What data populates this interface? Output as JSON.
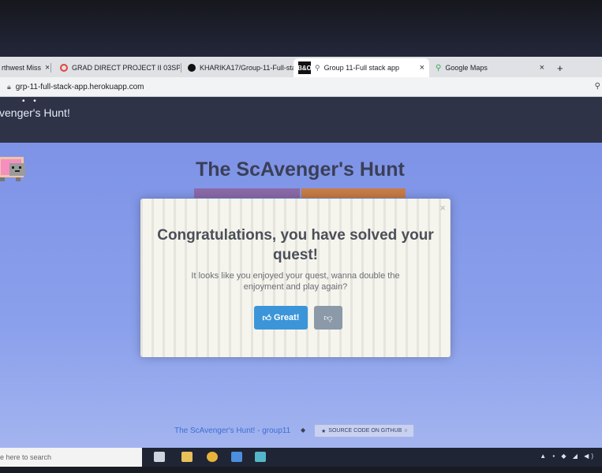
{
  "browser": {
    "tabs": [
      {
        "label": "rthwest Miss",
        "icon": "tab-favicon"
      },
      {
        "label": "GRAD DIRECT PROJECT II 03SP",
        "icon": "red-circle-favicon"
      },
      {
        "label": "KHARIKA17/Group-11-Full-sta",
        "icon": "github-icon"
      },
      {
        "label": "Group 11-Full stack app",
        "icon": "location-pin-icon",
        "active": true,
        "badge": "B&O"
      },
      {
        "label": "Google Maps",
        "icon": "maps-pin-icon"
      }
    ],
    "close_glyph": "×",
    "new_tab_glyph": "+",
    "url": "grp-11-full-stack-app.herokuapp.com"
  },
  "navbar": {
    "dots": "• •",
    "brand": "venger's Hunt!"
  },
  "page": {
    "title": "The ScAvenger's Hunt",
    "footer_link": "The ScAvenger's Hunt! - group11",
    "footer_sep": "◆",
    "source_button": "SOURCE CODE ON GITHUB"
  },
  "modal": {
    "title": "Congratulations, you have solved your quest!",
    "body": "It looks like you enjoyed your quest, wanna double the enjoyment and play again?",
    "great_label": "Great!",
    "close_glyph": "×"
  },
  "taskbar": {
    "search_placeholder": "e here to search"
  },
  "colors": {
    "page_bg": "#8ba0ec",
    "navbar": "#2e3347",
    "great_button": "#3b95d8",
    "dislike_button": "#8b99a8"
  }
}
